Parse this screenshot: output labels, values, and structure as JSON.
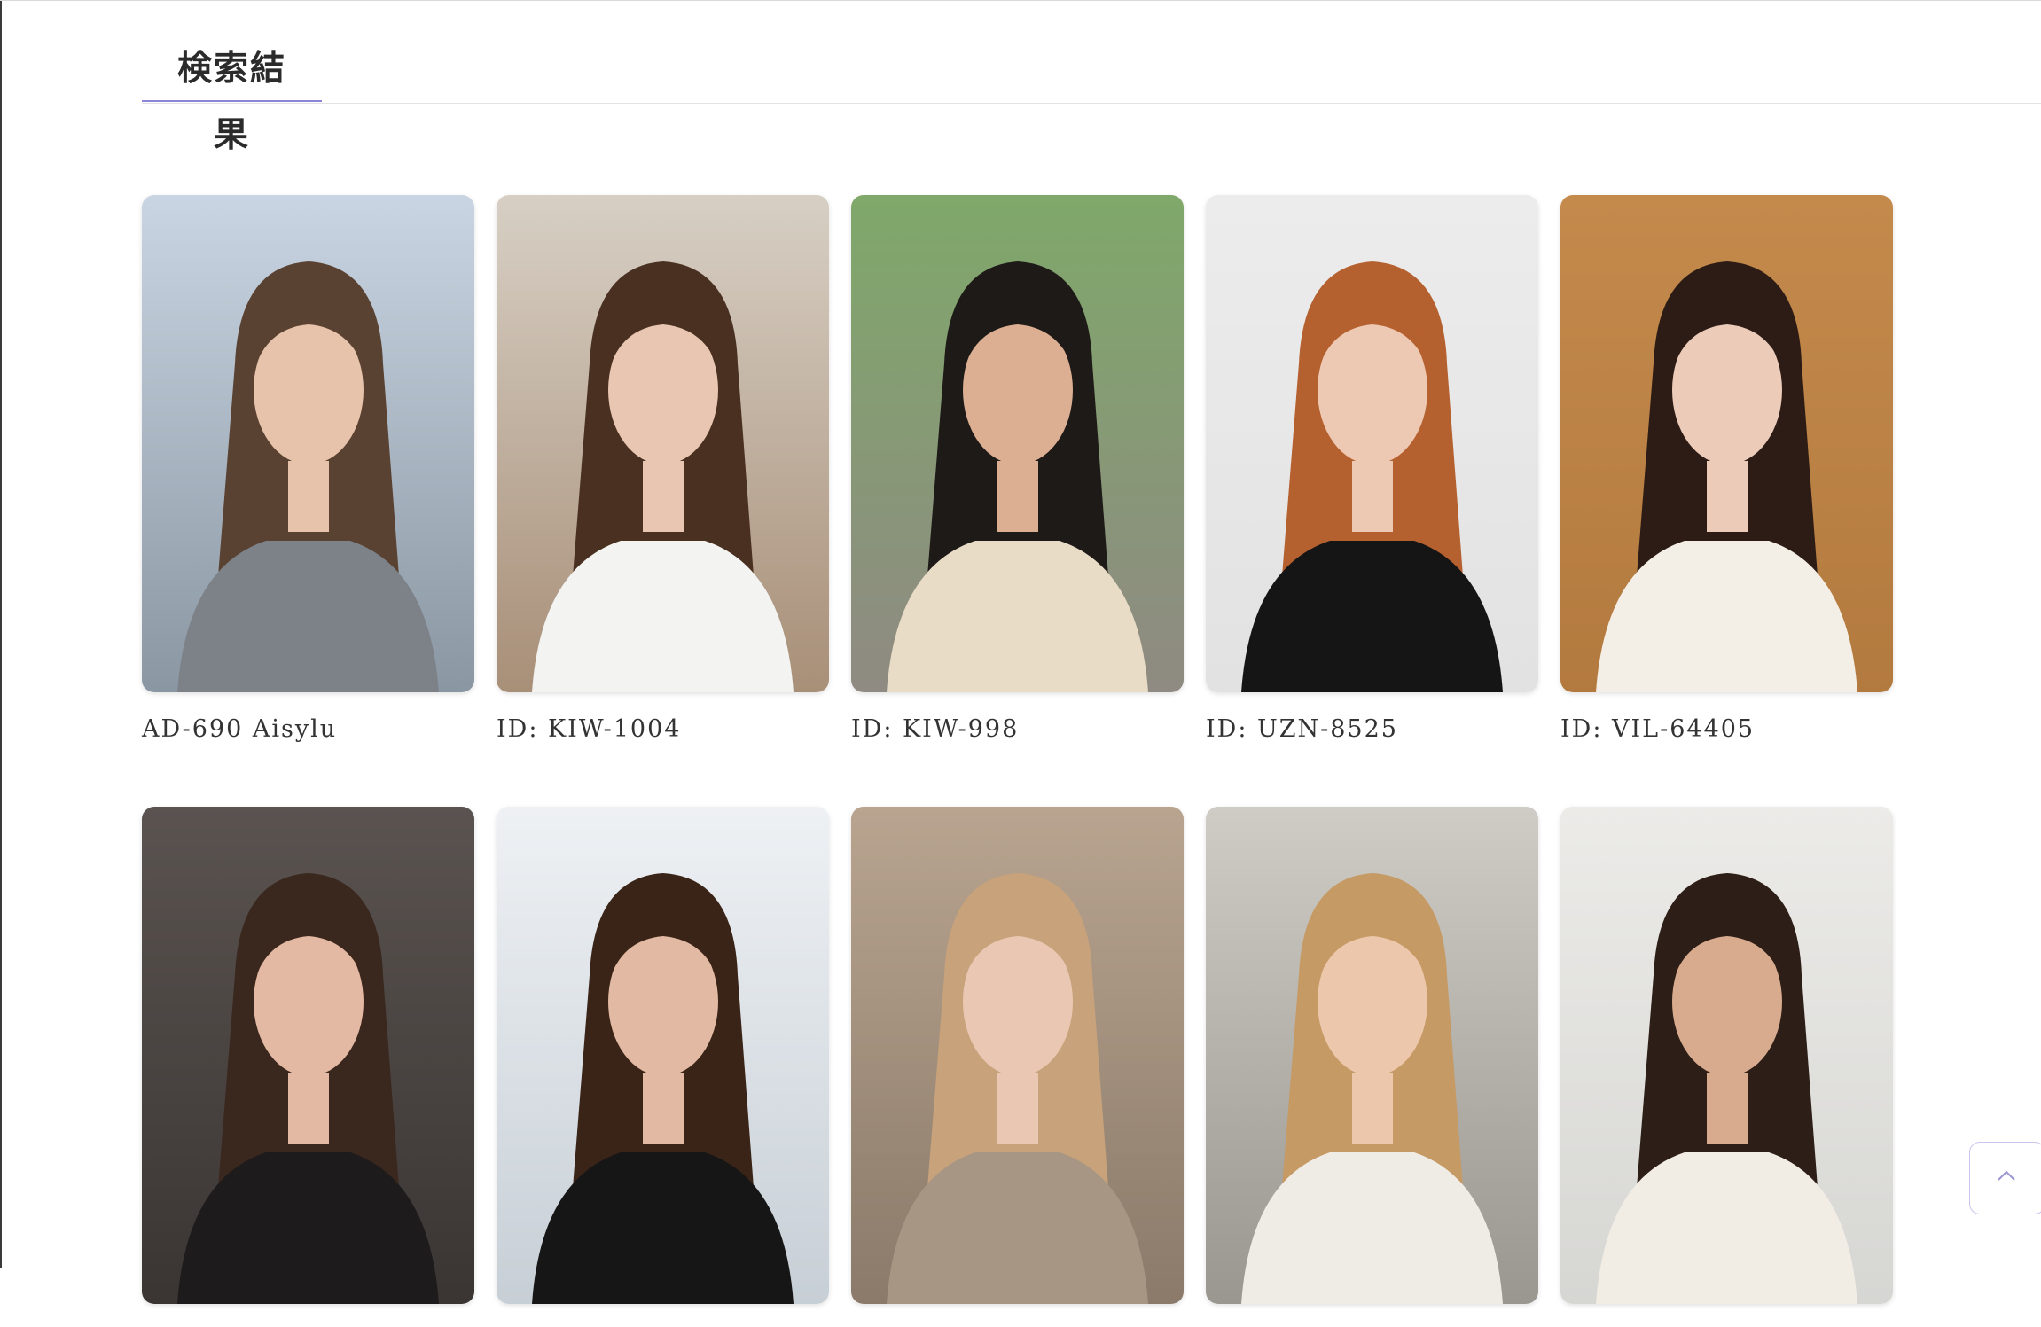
{
  "header": {
    "title": "検索結果"
  },
  "profiles": [
    {
      "id_label": "AD-690 Aisylu",
      "photo": {
        "bg": "#8a97a3",
        "top": "#c9d5e2",
        "hair": "#5a4232",
        "skin": "#e7c3ab",
        "outfit": "#7d8288"
      }
    },
    {
      "id_label": "ID: KIW-1004",
      "photo": {
        "bg": "#a88f78",
        "top": "#d7cfc4",
        "hair": "#4a3021",
        "skin": "#e8c6b1",
        "outfit": "#f3f3f1"
      }
    },
    {
      "id_label": "ID: KIW-998",
      "photo": {
        "bg": "#8f8a82",
        "top": "#7fa86a",
        "hair": "#1e1a18",
        "skin": "#dcae92",
        "outfit": "#e9dcc6"
      }
    },
    {
      "id_label": "ID: UZN-8525",
      "photo": {
        "bg": "#e2e2e2",
        "top": "#ececec",
        "hair": "#b5602f",
        "skin": "#edc8b2",
        "outfit": "#151515"
      }
    },
    {
      "id_label": "ID: VIL-64405",
      "photo": {
        "bg": "#b37a3f",
        "top": "#c48a4c",
        "hair": "#2d1c16",
        "skin": "#eccbb9",
        "outfit": "#f4efe6"
      }
    },
    {
      "id_label": "",
      "photo": {
        "bg": "#3a3533",
        "top": "#5a5350",
        "hair": "#3a271d",
        "skin": "#e4b9a3",
        "outfit": "#1d1b1b"
      }
    },
    {
      "id_label": "",
      "photo": {
        "bg": "#c7cfd6",
        "top": "#eef1f4",
        "hair": "#3a2418",
        "skin": "#e2b9a2",
        "outfit": "#161616"
      }
    },
    {
      "id_label": "",
      "photo": {
        "bg": "#8b7a6a",
        "top": "#b8a48f",
        "hair": "#c7a27a",
        "skin": "#eac7b2",
        "outfit": "#a89684"
      }
    },
    {
      "id_label": "",
      "photo": {
        "bg": "#9a9690",
        "top": "#cfccc6",
        "hair": "#c69a64",
        "skin": "#ecc7ac",
        "outfit": "#efece6"
      }
    },
    {
      "id_label": "",
      "photo": {
        "bg": "#d6d6d3",
        "top": "#ecebe8",
        "hair": "#2d1e17",
        "skin": "#d8ab8f",
        "outfit": "#f1ede4"
      }
    }
  ],
  "colors": {
    "accent": "#8b86d6",
    "text": "#2b2b2b"
  },
  "icons": {
    "scroll_top": "chevron-up-icon"
  }
}
